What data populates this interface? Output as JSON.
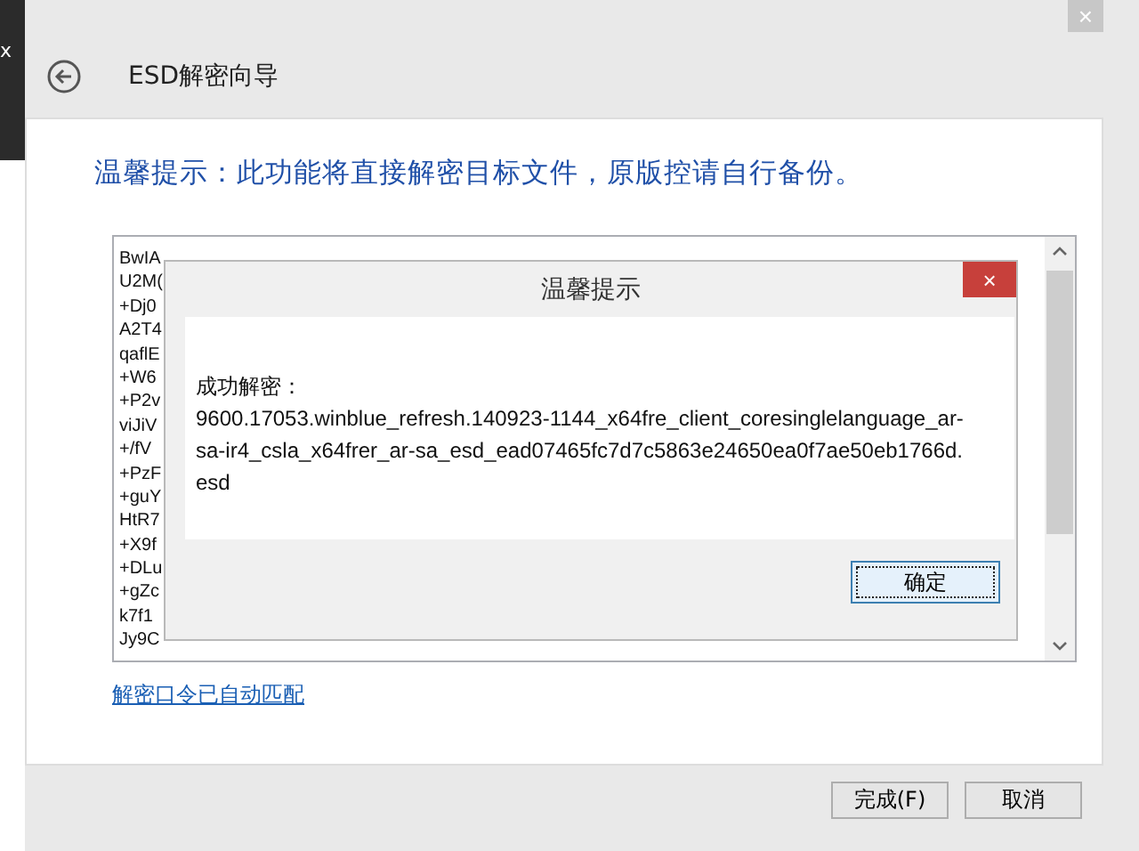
{
  "background_window": {
    "close_glyph": "x"
  },
  "window": {
    "title": "ESD解密向导",
    "close_glyph": "×"
  },
  "notice": "温馨提示：此功能将直接解密目标文件，原版控请自行备份。",
  "key_text": {
    "lines": [
      "BwIA",
      "U2M(",
      "+Dj0",
      "A2T4",
      "qaflE",
      "+W6",
      "+P2v",
      "viJiV",
      "+/fV",
      "+PzF",
      "+guY",
      "HtR7",
      "+X9f",
      "+DLu",
      "+gZc",
      "k7f1",
      "Jy9C"
    ]
  },
  "link": "解密口令已自动匹配",
  "buttons": [
    {
      "label": "完成(F)"
    },
    {
      "label": "取消"
    }
  ],
  "dialog": {
    "title": "温馨提示",
    "close_glyph": "×",
    "heading": "成功解密：",
    "message": "9600.17053.winblue_refresh.140923-1144_x64fre_client_coresinglelanguage_ar-sa-ir4_csla_x64frer_ar-sa_esd_ead07465fc7d7c5863e24650ea0f7ae50eb1766d.esd",
    "ok": "确定",
    "ok_focused": true
  }
}
